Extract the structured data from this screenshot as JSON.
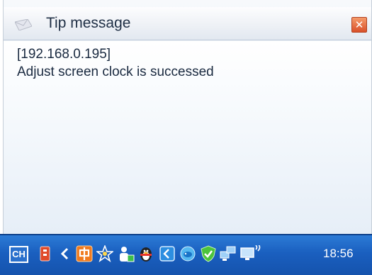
{
  "popup": {
    "title": "Tip message",
    "close_glyph": "✕",
    "message_lines": [
      "[192.168.0.195]",
      "Adjust screen clock is successed"
    ]
  },
  "taskbar": {
    "language": "CH",
    "clock": "18:56",
    "tray_icons": [
      "red-app-icon",
      "chevron-left-icon",
      "ime-zhong-icon",
      "star-icon",
      "user-security-icon",
      "qq-penguin-icon",
      "back-arrow-icon",
      "fish-icon",
      "green-check-shield-icon",
      "network-computers-icon",
      "wireless-monitor-icon"
    ]
  },
  "colors": {
    "taskbar_blue": "#1a5fbf",
    "close_red": "#d9502a",
    "text_dark": "#1a2a40"
  }
}
